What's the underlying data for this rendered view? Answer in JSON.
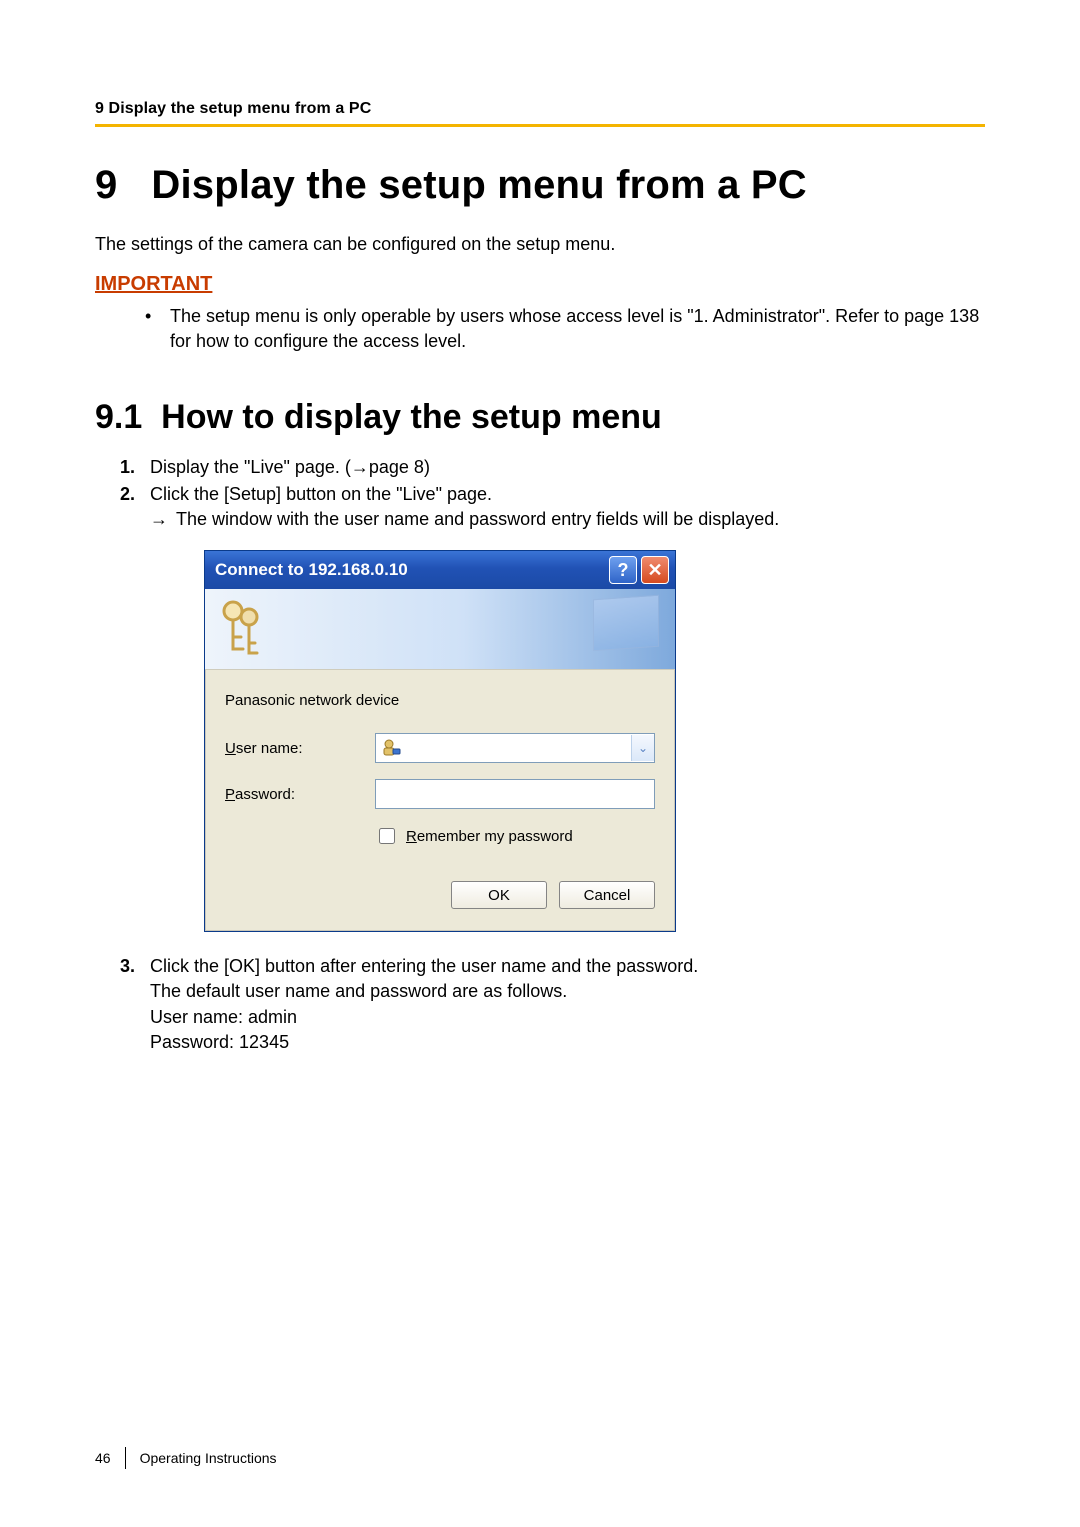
{
  "header": {
    "running": "9 Display the setup menu from a PC"
  },
  "section": {
    "number": "9",
    "title": "Display the setup menu from a PC",
    "intro": "The settings of the camera can be configured on the setup menu.",
    "important_label": "IMPORTANT",
    "important_note": "The setup menu is only operable by users whose access level is \"1. Administrator\". Refer to page 138 for how to configure the access level.",
    "sub_number": "9.1",
    "sub_title": "How to display the setup menu",
    "steps": {
      "s1": "Display the \"Live\" page. (→page 8)",
      "s2": "Click the [Setup] button on the \"Live\" page.",
      "s2_arrow": "→",
      "s2_sub": "The window with the user name and password entry fields will be displayed.",
      "s3": {
        "line1": "Click the [OK] button after entering the user name and the password.",
        "line2": "The default user name and password are as follows.",
        "line3": "User name: admin",
        "line4": "Password: 12345"
      }
    }
  },
  "dialog": {
    "title": "Connect to 192.168.0.10",
    "realm": "Panasonic network device",
    "user_label": "User name:",
    "pass_label": "Password:",
    "remember": "Remember my password",
    "ok": "OK",
    "cancel": "Cancel",
    "help_glyph": "?",
    "close_glyph": "✕",
    "chevron_glyph": "⌄"
  },
  "footer": {
    "page": "46",
    "doc": "Operating Instructions"
  }
}
